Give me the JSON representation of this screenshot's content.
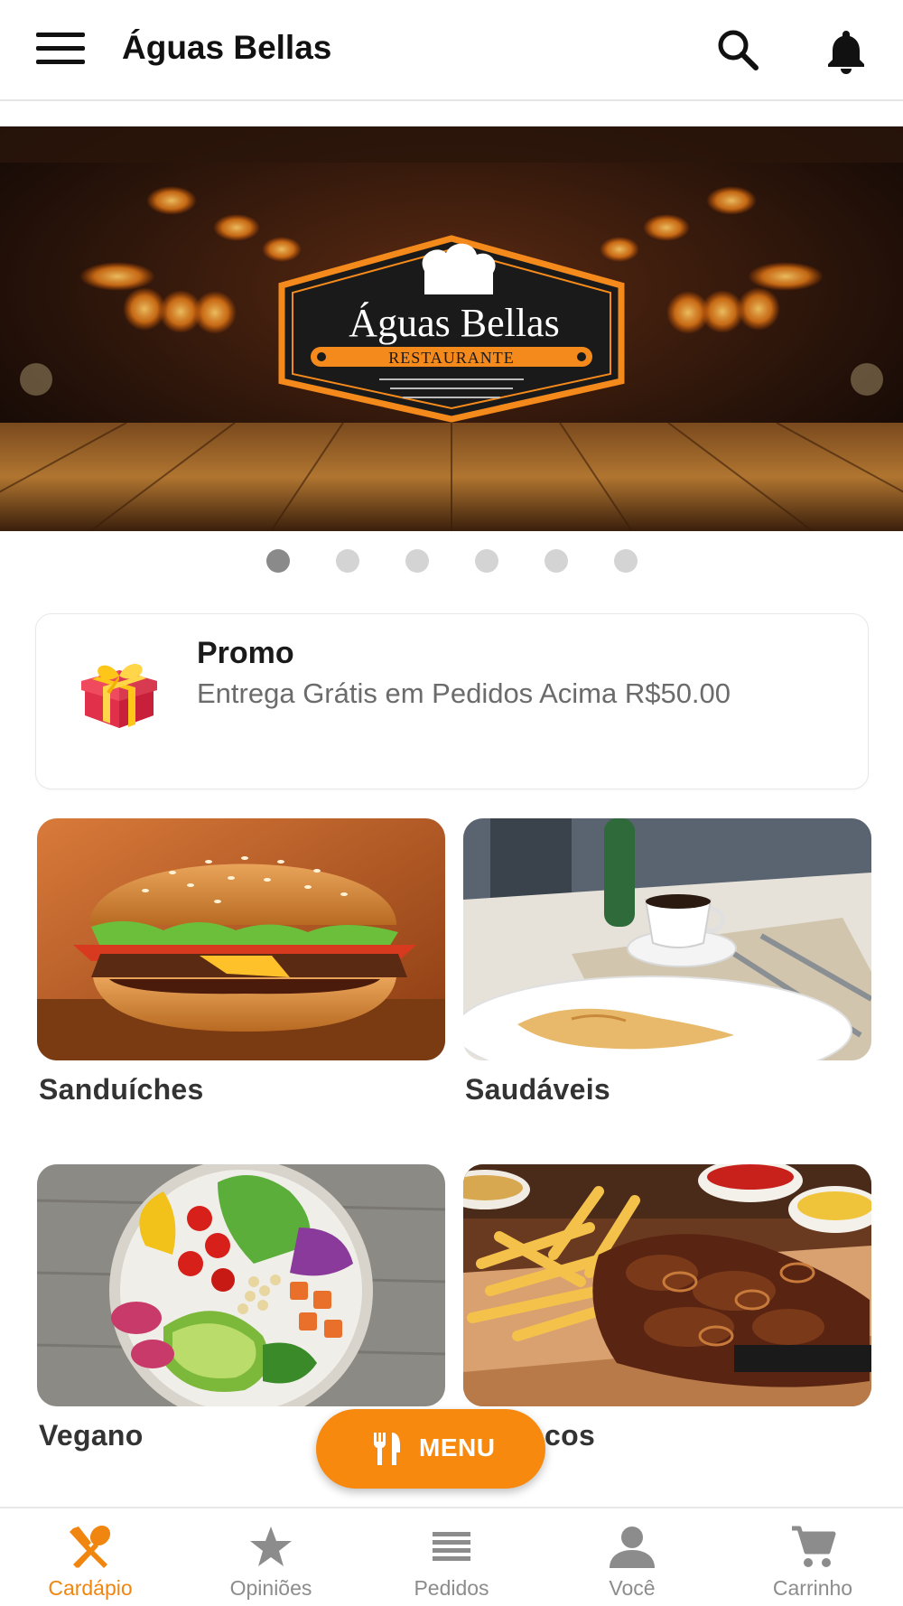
{
  "header": {
    "title": "Águas Bellas",
    "menu_icon": "hamburger-icon",
    "search_icon": "search-icon",
    "notification_icon": "bell-icon"
  },
  "banner": {
    "logo_title": "Águas Bellas",
    "logo_subtitle": "RESTAURANTE",
    "slide_count": 6,
    "active_slide": 1
  },
  "promo": {
    "title": "Promo",
    "text": "Entrega Grátis em Pedidos Acima R$50.00",
    "icon": "gift-icon"
  },
  "categories": [
    {
      "label": "Sanduíches",
      "image": "burger"
    },
    {
      "label": "Saudáveis",
      "image": "coffee-and-dessert"
    },
    {
      "label": "Vegano",
      "image": "salad-bowl"
    },
    {
      "label": "cos",
      "image": "steak-and-fries"
    }
  ],
  "fab": {
    "label": "MENU",
    "icon": "fork-knife-icon"
  },
  "bottom_nav": [
    {
      "label": "Cardápio",
      "icon": "fork-spoon-icon",
      "active": true
    },
    {
      "label": "Opiniões",
      "icon": "star-icon",
      "active": false
    },
    {
      "label": "Pedidos",
      "icon": "list-icon",
      "active": false
    },
    {
      "label": "Você",
      "icon": "person-icon",
      "active": false
    },
    {
      "label": "Carrinho",
      "icon": "cart-icon",
      "active": false
    }
  ],
  "colors": {
    "accent": "#f7890e",
    "nav_inactive": "#8c8c8c",
    "dot_active": "#8a8a8a",
    "dot_inactive": "#d4d4d4"
  }
}
